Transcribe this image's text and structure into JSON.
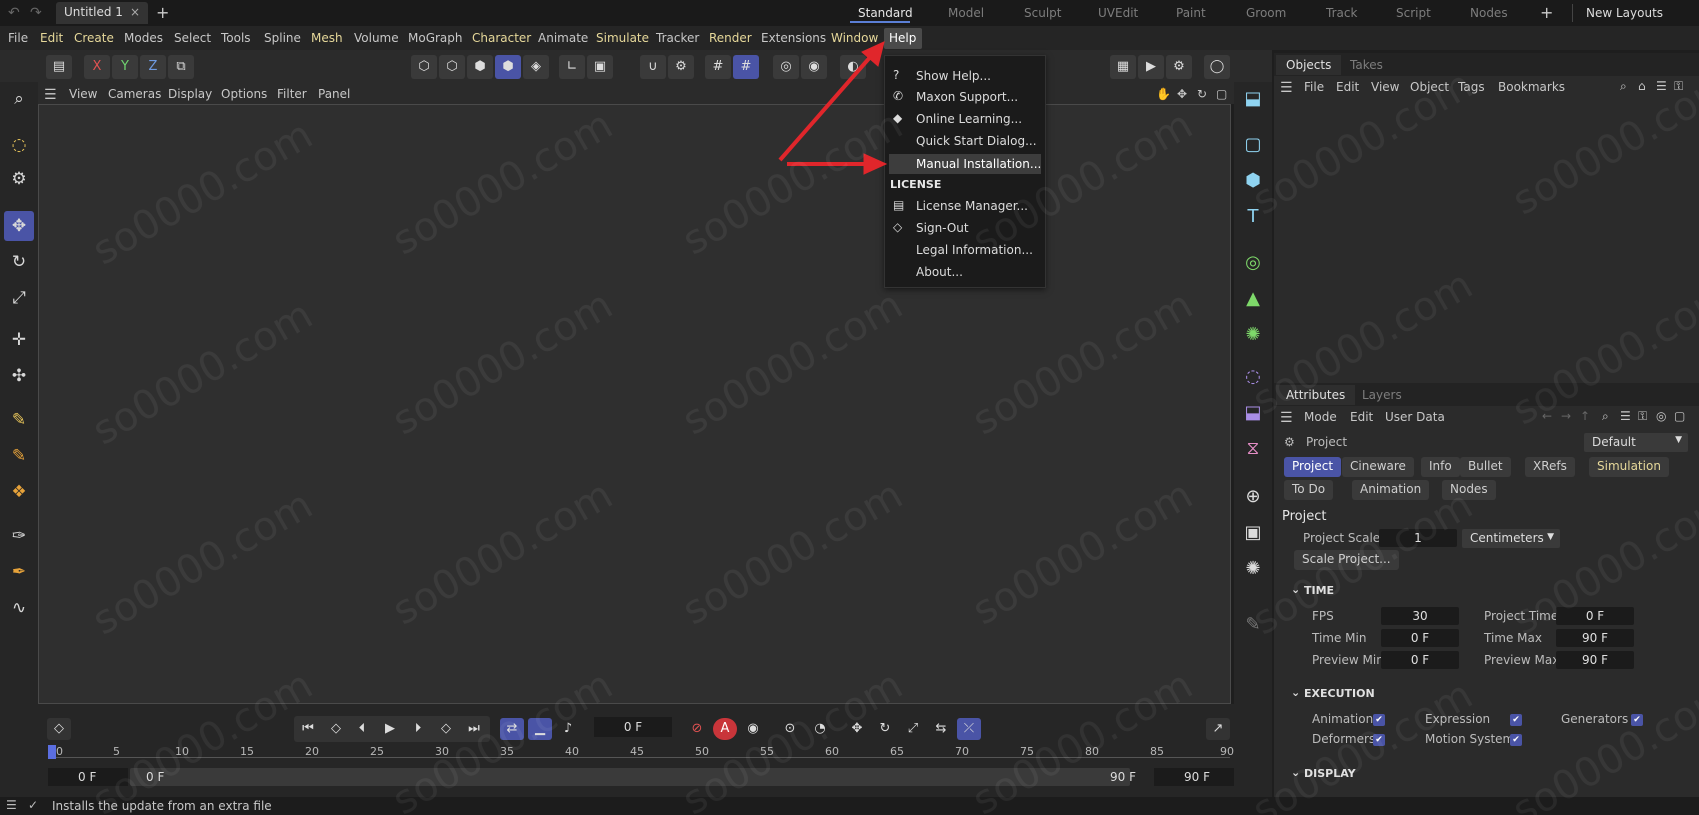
{
  "titlebar": {
    "doc_tab": "Untitled 1",
    "close_glyph": "×",
    "add_glyph": "+",
    "layouts": [
      "Standard",
      "Model",
      "Sculpt",
      "UVEdit",
      "Paint",
      "Groom",
      "Track",
      "Script",
      "Nodes"
    ],
    "new_layouts": "New Layouts"
  },
  "menubar": [
    "File",
    "Edit",
    "Create",
    "Modes",
    "Select",
    "Tools",
    "Spline",
    "Mesh",
    "Volume",
    "MoGraph",
    "Character",
    "Animate",
    "Simulate",
    "Tracker",
    "Render",
    "Extensions",
    "Window",
    "Help"
  ],
  "viewport_menu": [
    "View",
    "Cameras",
    "Display",
    "Options",
    "Filter",
    "Panel"
  ],
  "toolbar": {
    "axis_x": "X",
    "axis_y": "Y",
    "axis_z": "Z"
  },
  "help_menu": {
    "items": [
      "Show Help...",
      "Maxon Support...",
      "Online Learning...",
      "Quick Start Dialog...",
      "Manual Installation..."
    ],
    "section": "LICENSE",
    "license_items": [
      "License Manager...",
      "Sign-Out",
      "Legal Information...",
      "About..."
    ],
    "highlighted": "Manual Installation..."
  },
  "objects_panel": {
    "tabs": [
      "Objects",
      "Takes"
    ],
    "menu": [
      "File",
      "Edit",
      "View",
      "Object",
      "Tags",
      "Bookmarks"
    ]
  },
  "attributes_panel": {
    "tabs": [
      "Attributes",
      "Layers"
    ],
    "menu": [
      "Mode",
      "Edit",
      "User Data"
    ],
    "object": "Project",
    "preset": "Default",
    "pills_row1": [
      "Project",
      "Cineware",
      "Info",
      "Bullet",
      "XRefs",
      "Simulation"
    ],
    "pills_row2": [
      "To Do",
      "Animation",
      "Nodes"
    ],
    "heading": "Project",
    "project_scale_label": "Project Scale",
    "project_scale_value": "1",
    "project_scale_unit": "Centimeters",
    "scale_button": "Scale Project...",
    "time_section": "TIME",
    "fps_label": "FPS",
    "fps_value": "30",
    "project_time_label": "Project Time",
    "project_time_value": "0 F",
    "time_min_label": "Time Min",
    "time_min_value": "0 F",
    "time_max_label": "Time Max",
    "time_max_value": "90 F",
    "preview_min_label": "Preview Min",
    "preview_min_value": "0 F",
    "preview_max_label": "Preview Max",
    "preview_max_value": "90 F",
    "execution_section": "EXECUTION",
    "exec_animation": "Animation",
    "exec_expression": "Expression",
    "exec_generators": "Generators",
    "exec_deformers": "Deformers",
    "exec_motion": "Motion System",
    "display_section": "DISPLAY"
  },
  "timeline": {
    "current_frame": "0 F",
    "ticks": [
      "0",
      "5",
      "10",
      "15",
      "20",
      "25",
      "30",
      "35",
      "40",
      "45",
      "50",
      "55",
      "60",
      "65",
      "70",
      "75",
      "80",
      "85",
      "90"
    ],
    "start": "0 F",
    "range_start": "0 F",
    "range_end": "90 F",
    "end": "90 F"
  },
  "status": {
    "text": "Installs the update from an extra file"
  },
  "watermark": "so0000.com",
  "colors": {
    "accent": "#4a54a6",
    "arrow": "#e0262b",
    "highlight_text": "#e6d89a"
  }
}
